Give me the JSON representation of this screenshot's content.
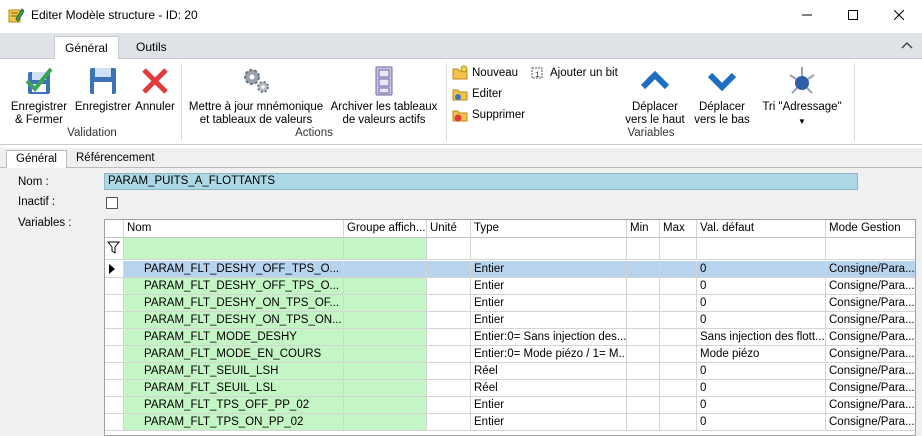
{
  "window": {
    "title": "Editer Modèle structure - ID: 20",
    "app_icon": "pencil-notebook-icon",
    "minimize_icon": "minimize-icon",
    "maximize_icon": "maximize-icon",
    "close_icon": "close-icon"
  },
  "ribbon": {
    "tabs": [
      {
        "label": "Général",
        "active": true
      },
      {
        "label": "Outils",
        "active": false
      }
    ],
    "groups": {
      "validation": {
        "label": "Validation",
        "save_close": "Enregistrer\n& Fermer",
        "save": "Enregistrer",
        "cancel": "Annuler"
      },
      "actions": {
        "label": "Actions",
        "update": "Mettre à jour mnémonique\net tableaux de valeurs",
        "archive": "Archiver les tableaux\nde valeurs actifs"
      },
      "variables": {
        "label": "Variables",
        "new": "Nouveau",
        "edit": "Editer",
        "delete": "Supprimer",
        "add_bit": "Ajouter un bit",
        "move_up": "Déplacer\nvers le haut",
        "move_down": "Déplacer\nvers le bas",
        "sort": "Tri \"Adressage\""
      }
    },
    "colors": {
      "save_green": "#3aa655",
      "cancel_red": "#e23a3a",
      "arrow_blue": "#1e6fc4"
    }
  },
  "form_tabs": [
    {
      "label": "Général",
      "active": true
    },
    {
      "label": "Référencement",
      "active": false
    }
  ],
  "form": {
    "name_label": "Nom :",
    "name_value": "PARAM_PUITS_A_FLOTTANTS",
    "inactive_label": "Inactif :",
    "inactive_checked": false,
    "variables_label": "Variables :"
  },
  "grid": {
    "columns": [
      "Nom",
      "Groupe affich...",
      "Unité",
      "Type",
      "Min",
      "Max",
      "Val. défaut",
      "Mode Gestion"
    ],
    "rows": [
      {
        "nom": "PARAM_FLT_DESHY_OFF_TPS_O...",
        "groupe": "",
        "unite": "",
        "type": "Entier",
        "min": "",
        "max": "",
        "val": "0",
        "mode": "Consigne/Para...",
        "selected": true
      },
      {
        "nom": "PARAM_FLT_DESHY_OFF_TPS_O...",
        "groupe": "",
        "unite": "",
        "type": "Entier",
        "min": "",
        "max": "",
        "val": "0",
        "mode": "Consigne/Para...",
        "selected": false
      },
      {
        "nom": "PARAM_FLT_DESHY_ON_TPS_OF...",
        "groupe": "",
        "unite": "",
        "type": "Entier",
        "min": "",
        "max": "",
        "val": "0",
        "mode": "Consigne/Para...",
        "selected": false
      },
      {
        "nom": "PARAM_FLT_DESHY_ON_TPS_ON...",
        "groupe": "",
        "unite": "",
        "type": "Entier",
        "min": "",
        "max": "",
        "val": "0",
        "mode": "Consigne/Para...",
        "selected": false
      },
      {
        "nom": "PARAM_FLT_MODE_DESHY",
        "groupe": "",
        "unite": "",
        "type": "Entier:0= Sans injection des...",
        "min": "",
        "max": "",
        "val": "Sans injection des flott...",
        "mode": "Consigne/Para...",
        "selected": false
      },
      {
        "nom": "PARAM_FLT_MODE_EN_COURS",
        "groupe": "",
        "unite": "",
        "type": "Entier:0= Mode piézo / 1= M...",
        "min": "",
        "max": "",
        "val": "Mode piézo",
        "mode": "Consigne/Para...",
        "selected": false
      },
      {
        "nom": "PARAM_FLT_SEUIL_LSH",
        "groupe": "",
        "unite": "",
        "type": "Réel",
        "min": "",
        "max": "",
        "val": "0",
        "mode": "Consigne/Para...",
        "selected": false
      },
      {
        "nom": "PARAM_FLT_SEUIL_LSL",
        "groupe": "",
        "unite": "",
        "type": "Réel",
        "min": "",
        "max": "",
        "val": "0",
        "mode": "Consigne/Para...",
        "selected": false
      },
      {
        "nom": "PARAM_FLT_TPS_OFF_PP_02",
        "groupe": "",
        "unite": "",
        "type": "Entier",
        "min": "",
        "max": "",
        "val": "0",
        "mode": "Consigne/Para...",
        "selected": false
      },
      {
        "nom": "PARAM_FLT_TPS_ON_PP_02",
        "groupe": "",
        "unite": "",
        "type": "Entier",
        "min": "",
        "max": "",
        "val": "0",
        "mode": "Consigne/Para...",
        "selected": false
      }
    ]
  }
}
